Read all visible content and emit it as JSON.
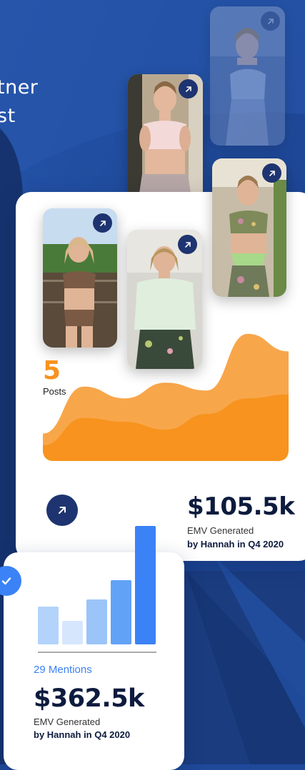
{
  "headline": {
    "line1": "tner",
    "line2": "st"
  },
  "photos": [
    {
      "name": "photo-top-right-faded",
      "icon": "arrow-up-right-icon"
    },
    {
      "name": "photo-pink-top",
      "icon": "arrow-up-right-icon"
    },
    {
      "name": "photo-camo-top",
      "icon": "arrow-up-right-icon"
    },
    {
      "name": "photo-lake-bikini",
      "icon": "arrow-up-right-icon"
    },
    {
      "name": "photo-green-tee",
      "icon": "arrow-up-right-icon"
    }
  ],
  "posts": {
    "count": "5",
    "label": "Posts"
  },
  "emv_card": {
    "value": "$105.5k",
    "label": "EMV Generated",
    "by": "by Hannah in Q4 2020",
    "icon": "arrow-up-right-icon"
  },
  "mentions_card": {
    "mentions": "29 Mentions",
    "value": "$362.5k",
    "label": "EMV Generated",
    "by": "by Hannah in Q4 2020",
    "icon": "checkmark-icon"
  },
  "colors": {
    "background": "#1f4a9a",
    "accent_orange": "#f7931e",
    "accent_blue": "#3b82f6",
    "navy": "#1e3470",
    "text_dark": "#0d1b3e"
  },
  "chart_data": [
    {
      "type": "area",
      "series": [
        {
          "values": [
            14,
            38,
            32,
            40,
            36,
            65,
            56
          ]
        },
        {
          "values": [
            8,
            22,
            20,
            16,
            24,
            32,
            34
          ]
        }
      ]
    },
    {
      "type": "bar",
      "values": [
        53,
        33,
        63,
        90,
        166
      ]
    }
  ]
}
